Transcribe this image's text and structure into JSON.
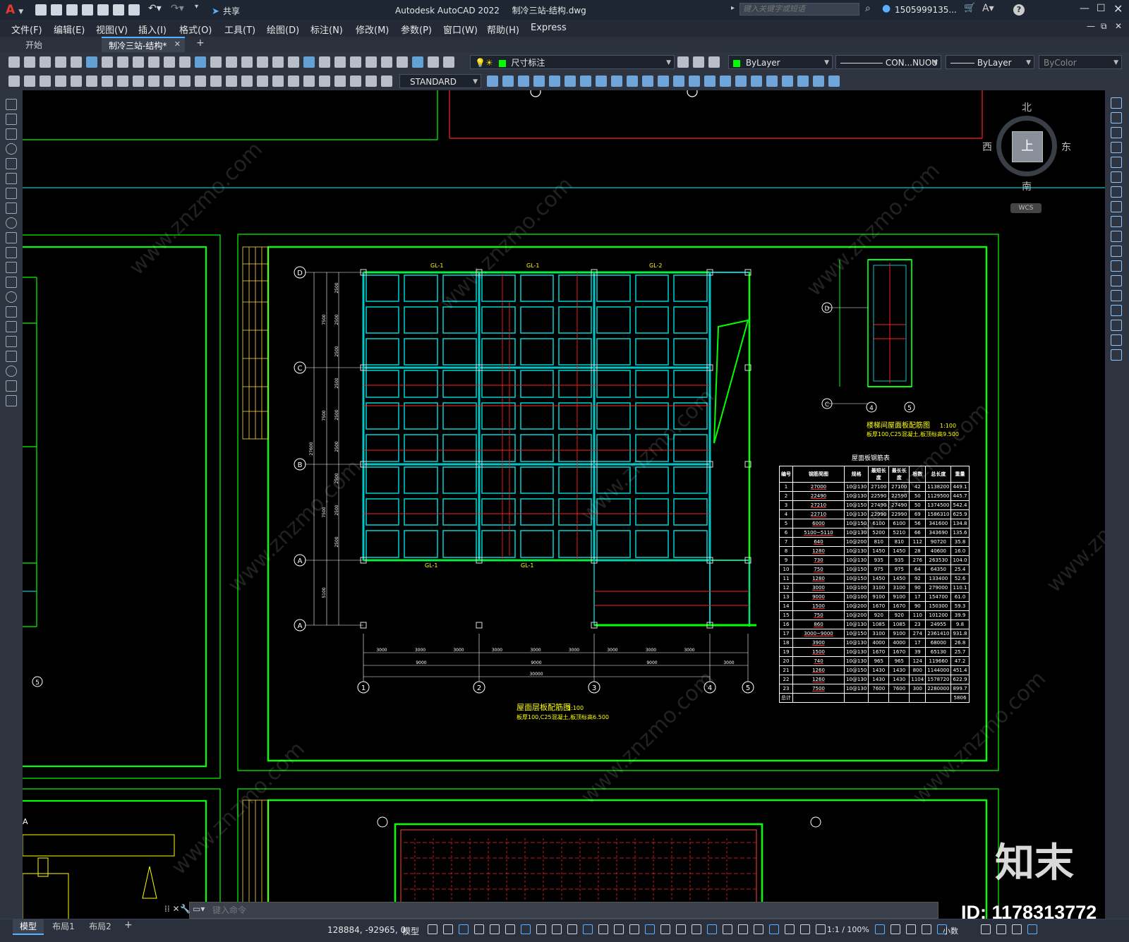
{
  "titlebar": {
    "app_title": "Autodesk AutoCAD 2022",
    "file_title": "制冷三站-结构.dwg",
    "share_label": "共享",
    "search_placeholder": "键入关键字或短语",
    "user_name": "1505999135...",
    "app_letter": "A"
  },
  "menu": [
    "文件(F)",
    "编辑(E)",
    "视图(V)",
    "插入(I)",
    "格式(O)",
    "工具(T)",
    "绘图(D)",
    "标注(N)",
    "修改(M)",
    "参数(P)",
    "窗口(W)",
    "帮助(H)",
    "Express"
  ],
  "tabs": {
    "start": "开始",
    "active": "制冷三站-结构*",
    "close": "✕",
    "add": "+"
  },
  "toolbar": {
    "layer_value": "尺寸标注",
    "color_value": "ByLayer",
    "linetype_value": "CON...NUOU",
    "lineweight_value": "ByLayer",
    "plotstyle_value": "ByColor",
    "textstyle_value": "STANDARD"
  },
  "viewcube": {
    "north": "北",
    "south": "南",
    "east": "东",
    "west": "西",
    "top": "上",
    "wcs": "WCS"
  },
  "drawing": {
    "main_title": "屋面层板配筋图",
    "main_scale": "1:100",
    "main_note": "板厚100,C25混凝土,板顶标高6.500",
    "stair_title": "楼梯间屋面板配筋图",
    "stair_scale": "1:100",
    "stair_note": "板厚100,C25混凝土,板顶标高9.500",
    "table_title": "屋面板钢筋表",
    "beam_labels": [
      "GL-1",
      "GL-1",
      "GL-2"
    ],
    "bottom_beams": [
      "GL-1",
      "GL-1"
    ],
    "axes_bottom": [
      "1",
      "2",
      "3",
      "4",
      "5"
    ],
    "axes_left": [
      "D",
      "C",
      "B",
      "A",
      "A"
    ],
    "dims_bottom": [
      "3000",
      "3000",
      "3000",
      "3000",
      "3000",
      "3000",
      "3000",
      "3000",
      "3000"
    ],
    "dims_mid": [
      "9000",
      "9000",
      "9000",
      "3000"
    ],
    "dim_total": "30000",
    "left_dims": [
      "2500",
      "2500",
      "2500",
      "2500",
      "2500",
      "2500",
      "2500",
      "2500",
      "2500"
    ],
    "left_dims2": [
      "7500",
      "7500",
      "7500",
      "5100"
    ],
    "left_total": "27600"
  },
  "rebar_table": {
    "headers": [
      "编号",
      "钢筋简图",
      "规格",
      "最短长度",
      "最长长度",
      "根数",
      "总长度",
      "重量"
    ],
    "rows": [
      [
        "1",
        "27000",
        "10@130",
        "27100",
        "27100",
        "42",
        "1138200",
        "449.1"
      ],
      [
        "2",
        "22490",
        "10@130",
        "22590",
        "22590",
        "50",
        "1129500",
        "445.7"
      ],
      [
        "3",
        "27210",
        "10@150",
        "27490",
        "27490",
        "50",
        "1374500",
        "542.4"
      ],
      [
        "4",
        "22710",
        "10@130",
        "22990",
        "22990",
        "69",
        "1586310",
        "625.9"
      ],
      [
        "5",
        "6000",
        "10@150",
        "6100",
        "6100",
        "56",
        "341600",
        "134.8"
      ],
      [
        "6",
        "5100~5110",
        "10@130",
        "5200",
        "5210",
        "66",
        "343690",
        "135.6"
      ],
      [
        "7",
        "640",
        "10@200",
        "810",
        "810",
        "112",
        "90720",
        "35.8"
      ],
      [
        "8",
        "1280",
        "10@130",
        "1450",
        "1450",
        "28",
        "40600",
        "16.0"
      ],
      [
        "9",
        "730",
        "10@130",
        "935",
        "935",
        "276",
        "263530",
        "104.0"
      ],
      [
        "10",
        "750",
        "10@150",
        "975",
        "975",
        "64",
        "64350",
        "25.4"
      ],
      [
        "11",
        "1280",
        "10@150",
        "1450",
        "1450",
        "92",
        "133400",
        "52.6"
      ],
      [
        "12",
        "3000",
        "10@100",
        "3100",
        "3100",
        "90",
        "279000",
        "110.1"
      ],
      [
        "13",
        "9000",
        "10@100",
        "9100",
        "9100",
        "17",
        "154700",
        "61.0"
      ],
      [
        "14",
        "1500",
        "10@200",
        "1670",
        "1670",
        "90",
        "150300",
        "59.3"
      ],
      [
        "15",
        "750",
        "10@200",
        "920",
        "920",
        "110",
        "101200",
        "39.9"
      ],
      [
        "16",
        "860",
        "10@130",
        "1085",
        "1085",
        "23",
        "24955",
        "9.8"
      ],
      [
        "17",
        "3000~9000",
        "10@150",
        "3100",
        "9100",
        "274",
        "2361410",
        "931.8"
      ],
      [
        "18",
        "3900",
        "10@130",
        "4000",
        "4000",
        "17",
        "68000",
        "26.8"
      ],
      [
        "19",
        "1500",
        "10@130",
        "1670",
        "1670",
        "39",
        "65130",
        "25.7"
      ],
      [
        "20",
        "740",
        "10@130",
        "965",
        "965",
        "124",
        "119660",
        "47.2"
      ],
      [
        "21",
        "1260",
        "10@150",
        "1430",
        "1430",
        "800",
        "1144000",
        "451.4"
      ],
      [
        "22",
        "1260",
        "10@130",
        "1430",
        "1430",
        "1104",
        "1578720",
        "622.9"
      ],
      [
        "23",
        "7500",
        "10@130",
        "7600",
        "7600",
        "300",
        "2280000",
        "899.7"
      ]
    ],
    "total_label": "总计",
    "total_value": "5806"
  },
  "command": {
    "placeholder": "键入命令"
  },
  "layout_tabs": [
    "模型",
    "布局1",
    "布局2"
  ],
  "status": {
    "coords": "128884, -92965, 0",
    "mode": "模型",
    "scale": "1:1 / 100%",
    "units": "小数"
  },
  "watermark": {
    "site": "www.znzmo.com",
    "brand": "知末",
    "id_label": "ID: 1178313772"
  }
}
